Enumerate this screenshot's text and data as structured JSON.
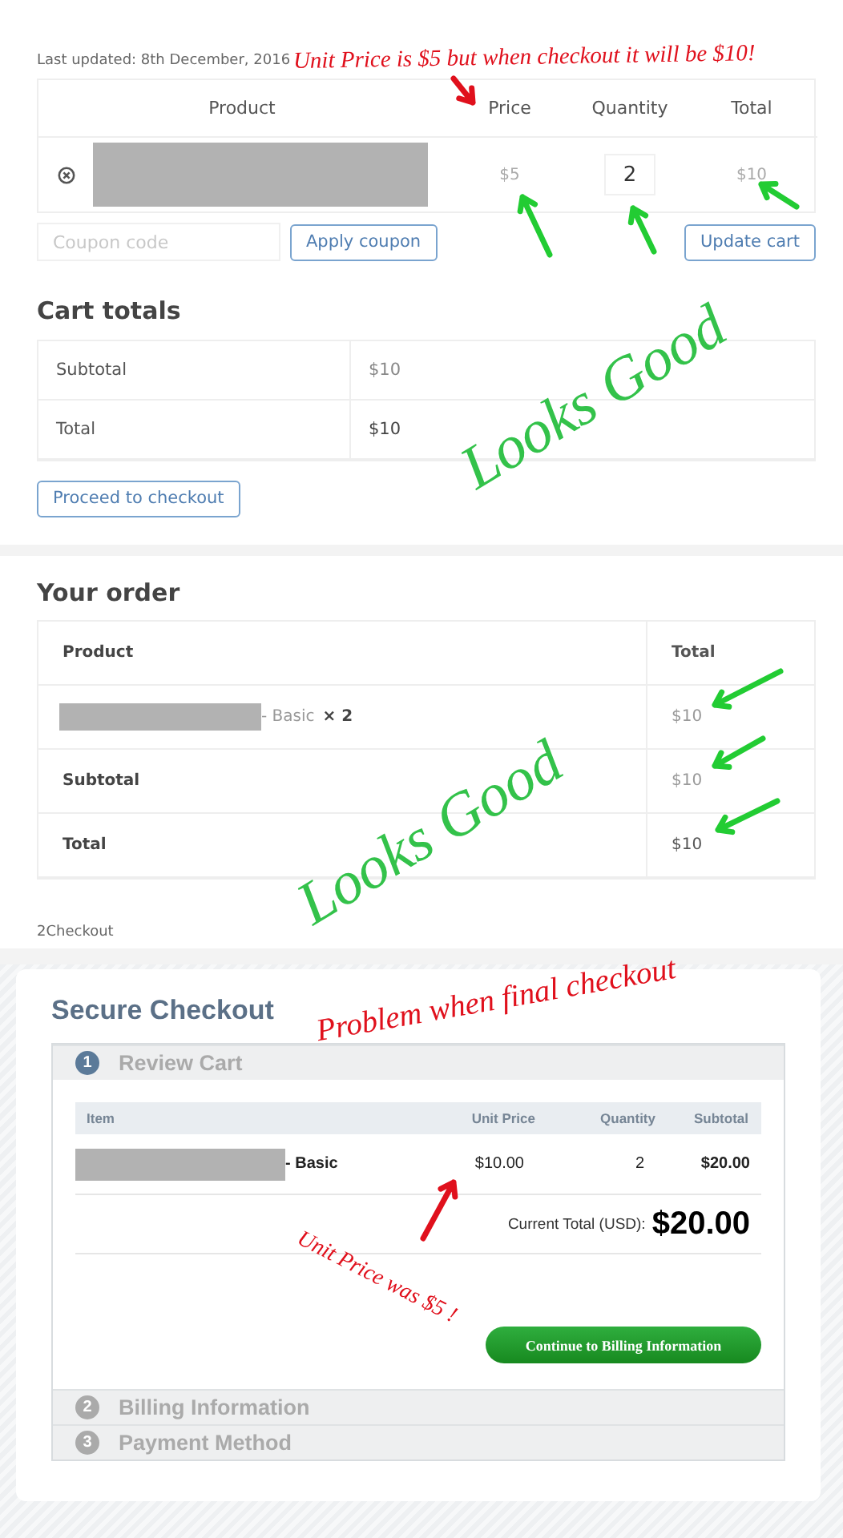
{
  "cart": {
    "last_updated": "Last updated: 8th December, 2016",
    "columns": [
      "Product",
      "Price",
      "Quantity",
      "Total"
    ],
    "items": [
      {
        "price": "$5",
        "quantity": "2",
        "total": "$10"
      }
    ],
    "coupon": {
      "placeholder": "Coupon code"
    },
    "apply_button": "Apply coupon",
    "update_button": "Update cart"
  },
  "cart_totals": {
    "title": "Cart totals",
    "rows": [
      {
        "label": "Subtotal",
        "value": "$10"
      },
      {
        "label": "Total",
        "value": "$10"
      }
    ],
    "checkout_button": "Proceed to checkout"
  },
  "order": {
    "title": "Your order",
    "columns": [
      "Product",
      "Total"
    ],
    "rows": [
      {
        "kind": "item",
        "suffix": "- Basic",
        "quantity": "× 2",
        "total": "$10"
      },
      {
        "kind": "summary",
        "label": "Subtotal",
        "total": "$10"
      },
      {
        "kind": "summary",
        "label": "Total",
        "total": "$10"
      }
    ],
    "payment_method": "2Checkout"
  },
  "secure_checkout": {
    "title": "Secure Checkout",
    "steps": [
      {
        "number": "1",
        "label": "Review Cart",
        "expanded": true
      },
      {
        "number": "2",
        "label": "Billing Information",
        "expanded": false
      },
      {
        "number": "3",
        "label": "Payment Method",
        "expanded": false
      }
    ],
    "columns": [
      "Item",
      "Unit Price",
      "Quantity",
      "Subtotal"
    ],
    "items": [
      {
        "suffix": "- Basic",
        "unit_price": "$10.00",
        "quantity": "2",
        "subtotal": "$20.00"
      }
    ],
    "total_label": "Current Total (USD):",
    "total": "$20.00",
    "continue_button": "Continue to Billing Information"
  },
  "annotations": [
    {
      "text": "Unit Price is $5 but when checkout it will be $10!",
      "color": "#e0101c"
    },
    {
      "text": "Looks Good",
      "color": "#33c24a"
    },
    {
      "text": "Looks Good",
      "color": "#33c24a"
    },
    {
      "text": "Problem when final checkout",
      "color": "#e0101c"
    },
    {
      "text": "Unit Price was $5 !",
      "color": "#e0101c"
    }
  ]
}
